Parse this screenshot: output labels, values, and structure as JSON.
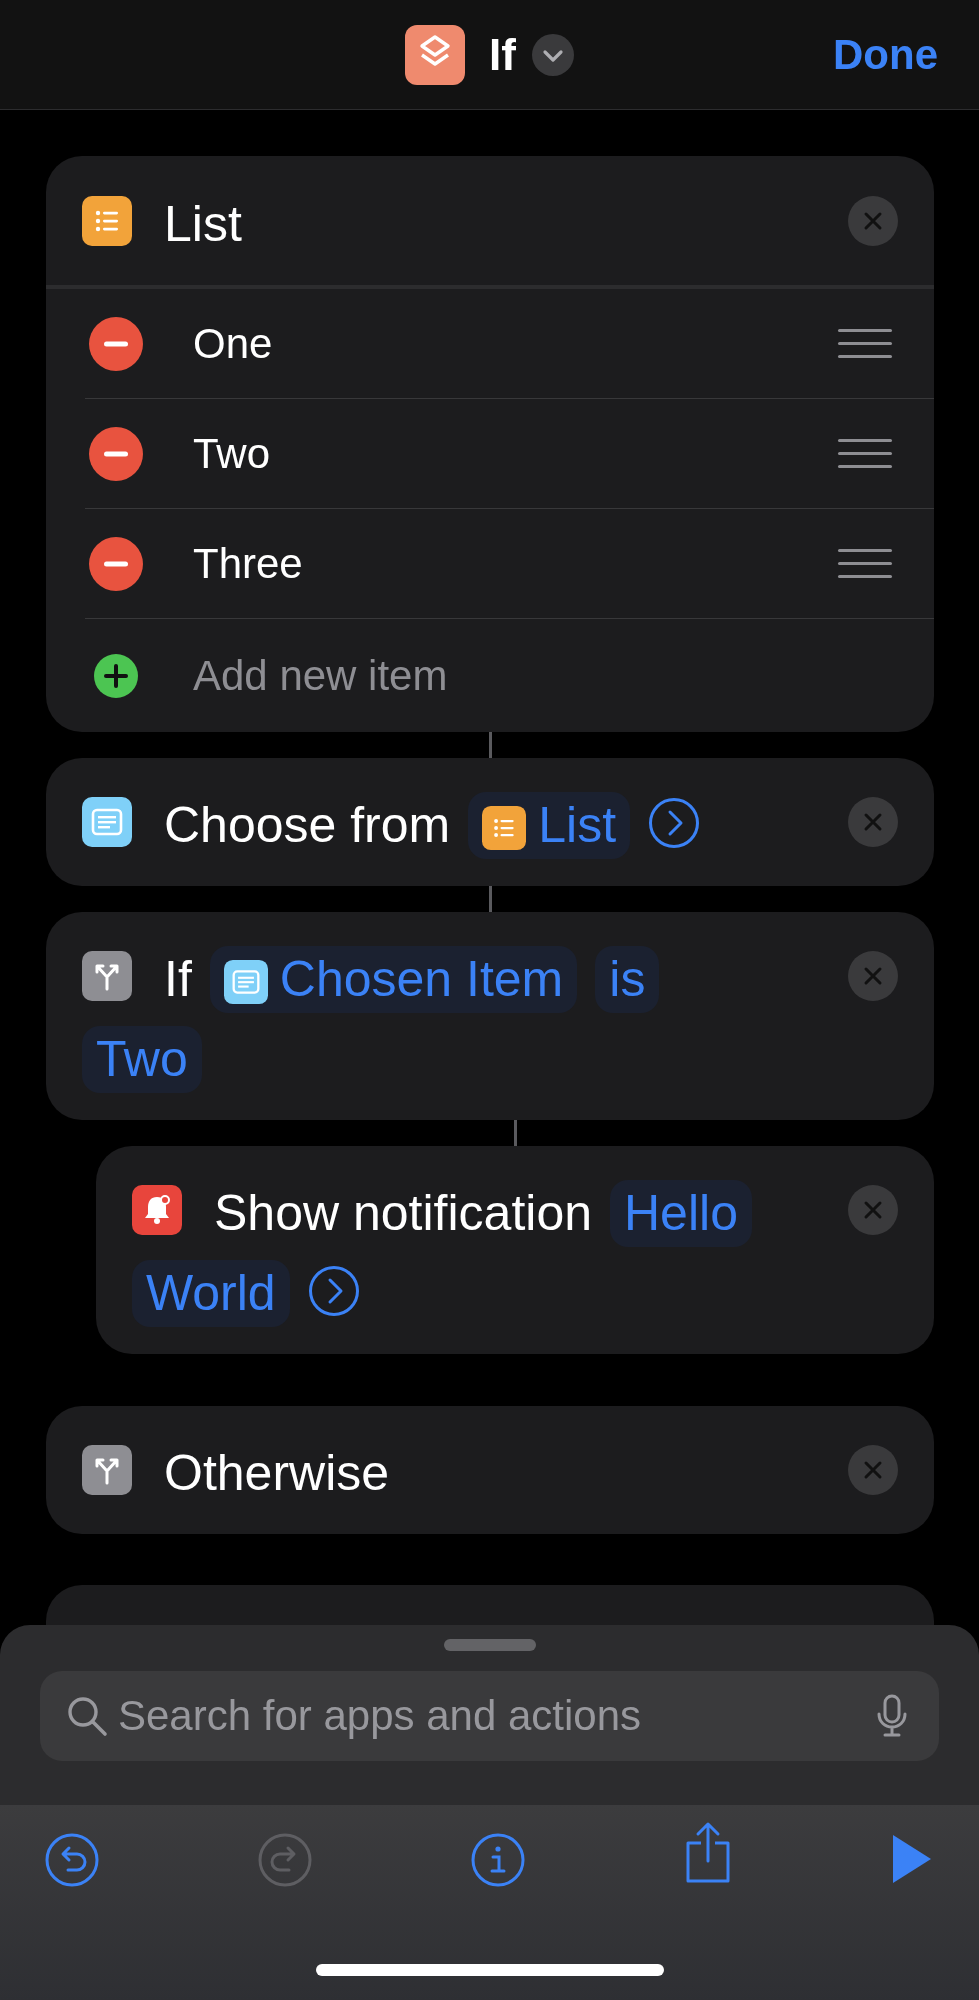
{
  "header": {
    "title": "If",
    "done_label": "Done"
  },
  "actions": [
    {
      "kind": "list",
      "indented": false,
      "linked": false,
      "parts": [
        {
          "kind": "text",
          "text": "List"
        }
      ],
      "expand_button": false,
      "items": [
        {
          "text": "One"
        },
        {
          "text": "Two"
        },
        {
          "text": "Three"
        }
      ],
      "add_item_label": "Add new item"
    },
    {
      "kind": "choose",
      "indented": false,
      "linked": true,
      "parts": [
        {
          "kind": "text",
          "text": "Choose from"
        },
        {
          "kind": "list_variable",
          "text": "List"
        }
      ],
      "expand_button": true
    },
    {
      "kind": "branch",
      "indented": false,
      "linked": true,
      "parts": [
        {
          "kind": "text",
          "text": "If"
        },
        {
          "kind": "choose_variable",
          "text": "Chosen Item"
        },
        {
          "kind": "token",
          "text": "is"
        },
        {
          "kind": "token",
          "text": "Two"
        }
      ],
      "expand_button": false
    },
    {
      "kind": "notification",
      "indented": true,
      "linked": true,
      "parts": [
        {
          "kind": "text",
          "text": "Show notification"
        },
        {
          "kind": "token",
          "text": "Hello"
        },
        {
          "kind": "token",
          "text": "World"
        }
      ],
      "expand_button": true
    },
    {
      "kind": "branch",
      "indented": false,
      "linked": false,
      "parts": [
        {
          "kind": "text",
          "text": "Otherwise"
        }
      ],
      "expand_button": false
    }
  ],
  "search": {
    "placeholder": "Search for apps and actions"
  },
  "toolbar": [
    {
      "kind": "undo",
      "disabled": false
    },
    {
      "kind": "redo",
      "disabled": true
    },
    {
      "kind": "info",
      "disabled": false
    },
    {
      "kind": "share",
      "disabled": false
    },
    {
      "kind": "run",
      "disabled": false
    }
  ]
}
